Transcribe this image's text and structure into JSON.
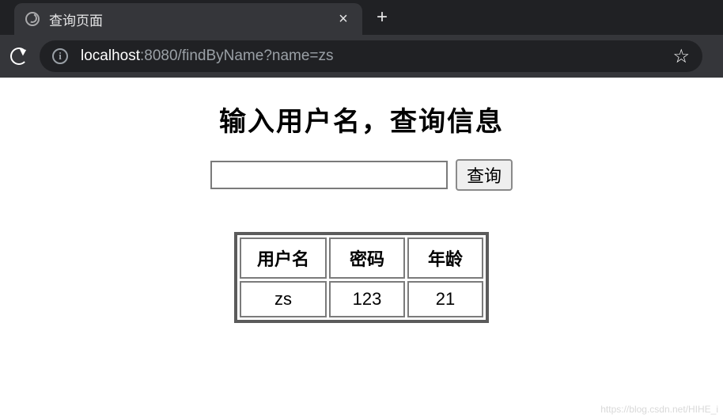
{
  "browser": {
    "tab": {
      "title": "查询页面",
      "close_glyph": "×",
      "new_tab_glyph": "+"
    },
    "url": {
      "host": "localhost",
      "port_and_path": ":8080/findByName?name=zs"
    },
    "info_glyph": "i",
    "star_glyph": "☆"
  },
  "page": {
    "title": "输入用户名，查询信息",
    "search": {
      "value": "",
      "button_label": "查询"
    },
    "table": {
      "headers": [
        "用户名",
        "密码",
        "年龄"
      ],
      "rows": [
        [
          "zs",
          "123",
          "21"
        ]
      ]
    }
  },
  "watermark": "https://blog.csdn.net/HIHE_i"
}
